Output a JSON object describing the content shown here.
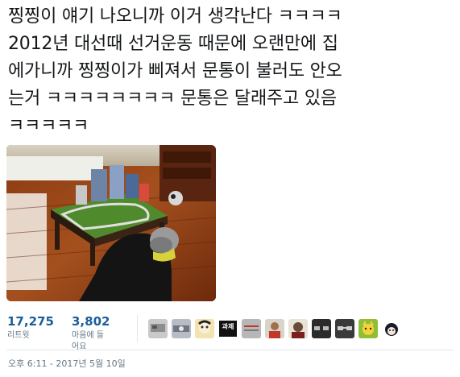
{
  "tweet": {
    "lines": [
      "찡찡이 얘기 나오니까 이거 생각난다 ㅋㅋㅋㅋ",
      "2012년 대선때 선거운동 때문에 오랜만에 집",
      "에가니까 찡찡이가 삐져서 문통이 불러도 안오",
      "는거 ㅋㅋㅋㅋㅋㅋㅋㅋ 문통은 달래주고 있음",
      "ㅋㅋㅋㅋㅋ"
    ]
  },
  "photo": {
    "description_icon": "photo-image"
  },
  "stats": {
    "retweets": {
      "count": "17,275",
      "label": "리트윗"
    },
    "likes": {
      "count": "3,802",
      "label": "마음에 들어요"
    }
  },
  "avatars": [
    {
      "icon": "avatar-1",
      "color": "#c9c9c9"
    },
    {
      "icon": "avatar-2",
      "color": "#b8bcc4"
    },
    {
      "icon": "avatar-3",
      "color": "#f2e3b0"
    },
    {
      "icon": "avatar-4",
      "color": "#111111",
      "text": "과제"
    },
    {
      "icon": "avatar-5",
      "color": "#b7b7b7"
    },
    {
      "icon": "avatar-6",
      "color": "#d9d4c8"
    },
    {
      "icon": "avatar-7",
      "color": "#6b4a3a"
    },
    {
      "icon": "avatar-8",
      "color": "#2b2b2b"
    },
    {
      "icon": "avatar-9",
      "color": "#3a3a3a"
    },
    {
      "icon": "avatar-10",
      "color": "#8fbf3a"
    },
    {
      "icon": "avatar-11",
      "color": "#ffffff"
    }
  ],
  "timestamp": "오후 6:11 - 2017년 5월 10일",
  "colors": {
    "accent": "#1b5e99",
    "muted": "#657786",
    "divider": "#e1e8ed"
  }
}
